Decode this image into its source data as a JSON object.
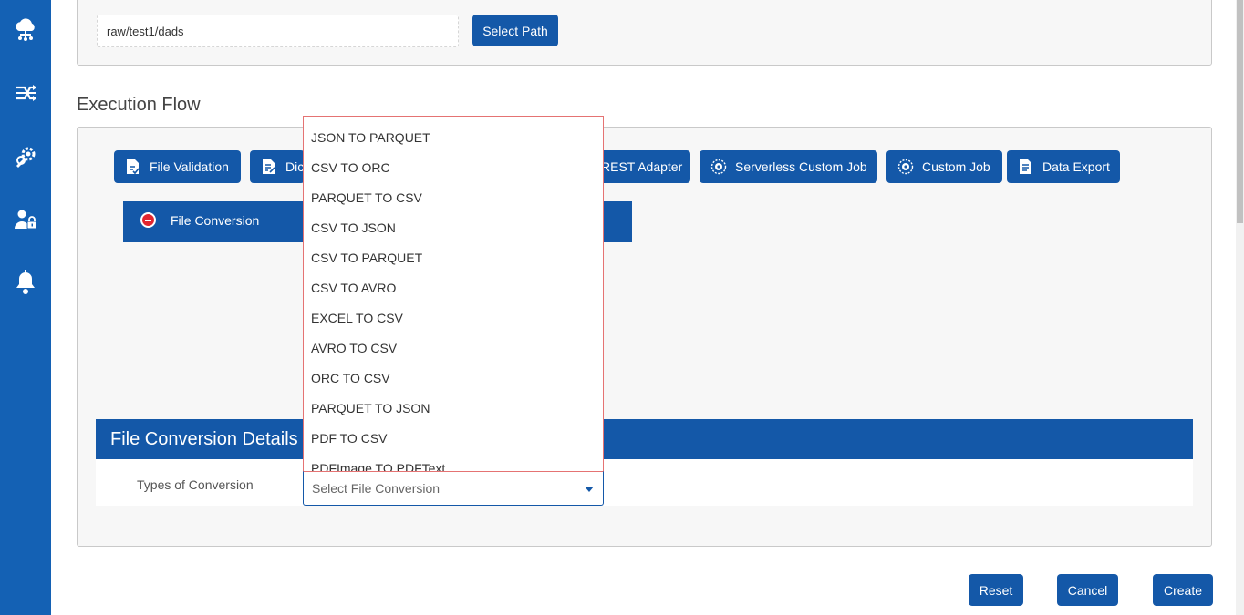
{
  "sidebar": {
    "icons": [
      "cloud-network-icon",
      "shuffle-flow-icon",
      "wrench-gear-icon",
      "user-lock-icon",
      "bell-icon"
    ]
  },
  "path": {
    "value": "raw/test1/dads",
    "select_label": "Select Path"
  },
  "execution_flow": {
    "title": "Execution Flow",
    "buttons": [
      {
        "label": "File Validation",
        "icon": "file-check-icon"
      },
      {
        "label": "Dic",
        "icon": "file-edit-icon"
      },
      {
        "label": "REST Adapter",
        "icon": ""
      },
      {
        "label": "Serverless Custom Job",
        "icon": "gear-circle-icon"
      },
      {
        "label": "Custom Job",
        "icon": "gear-circle-icon"
      },
      {
        "label": "Data Export",
        "icon": "document-icon"
      }
    ],
    "stage": {
      "label": "File Conversion",
      "icon": "remove-icon"
    }
  },
  "details": {
    "title": "File Conversion Details",
    "conversion_label": "Types of Conversion",
    "select_placeholder": "Select File Conversion"
  },
  "dropdown_options": [
    "JSON TO PARQUET",
    "CSV TO ORC",
    "PARQUET TO CSV",
    "CSV TO JSON",
    "CSV TO PARQUET",
    "CSV TO AVRO",
    "EXCEL TO CSV",
    "AVRO TO CSV",
    "ORC TO CSV",
    "PARQUET TO JSON",
    "PDF TO CSV",
    "PDFImage TO PDFText"
  ],
  "actions": {
    "reset": "Reset",
    "cancel": "Cancel",
    "create": "Create"
  },
  "colors": {
    "primary": "#1458a8",
    "sidebar": "#1461b4",
    "danger": "#e3262f",
    "dropdown_border": "#e57373"
  }
}
